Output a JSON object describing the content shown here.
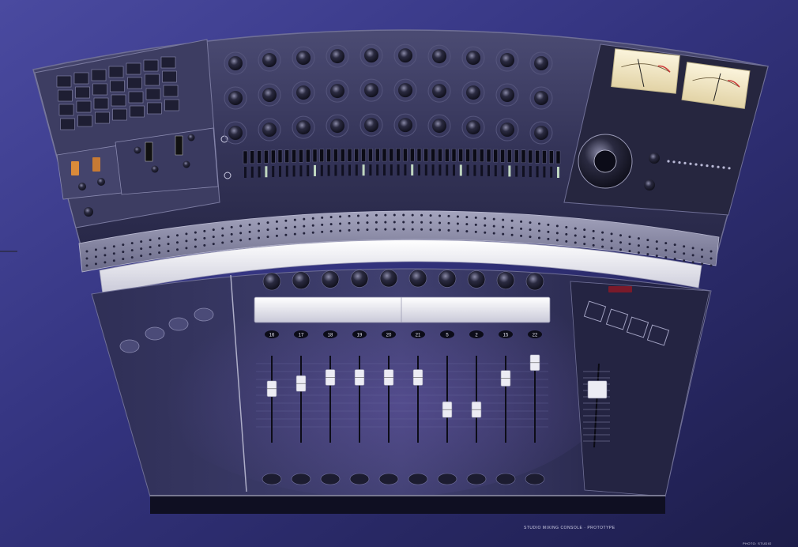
{
  "photo": {
    "subject": "mixing-console",
    "caption": "STUDIO MIXING CONSOLE · PROTOTYPE",
    "credit": "PHOTO: STUDIO"
  },
  "colors": {
    "backdrop_top": "#3a3a86",
    "backdrop_bottom": "#23235a",
    "panel": "#34345a",
    "panel_dark": "#1c1c33",
    "metal": "#8e8ea6",
    "strip": "#e9e9f1",
    "meter_face": "#f0e6c8"
  },
  "channel_labels": [
    "16",
    "17",
    "18",
    "19",
    "20",
    "21",
    "5",
    "2",
    "15",
    "22"
  ],
  "fader_levels": [
    0.62,
    0.68,
    0.75,
    0.75,
    0.75,
    0.75,
    0.38,
    0.38,
    0.74,
    0.92
  ],
  "master_level": 0.7,
  "meters": [
    {
      "needle": 0.35
    },
    {
      "needle": 0.55
    }
  ],
  "knob_rows": 3,
  "knobs_per_row": 10,
  "keypad": {
    "rows": 4,
    "cols": 7
  }
}
